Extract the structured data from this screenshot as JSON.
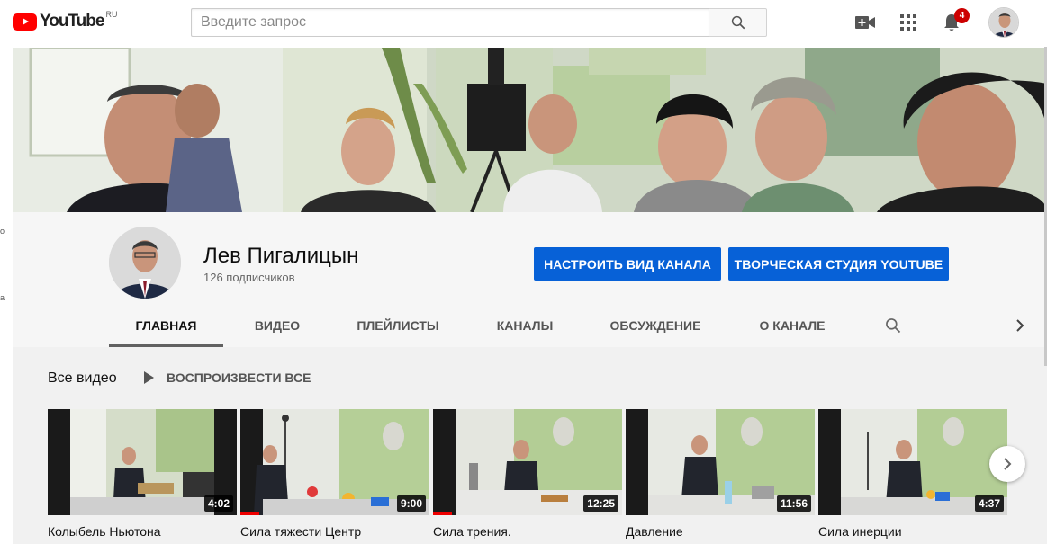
{
  "masthead": {
    "logo_text": "YouTube",
    "logo_region": "RU",
    "search_placeholder": "Введите запрос",
    "notification_count": "4",
    "icons": [
      "video-camera-icon",
      "apps-grid-icon",
      "bell-icon"
    ]
  },
  "channel": {
    "name": "Лев Пигалицын",
    "subscribers": "126 подписчиков",
    "customize_label": "НАСТРОИТЬ ВИД КАНАЛА",
    "studio_label": "ТВОРЧЕСКАЯ СТУДИЯ YOUTUBE"
  },
  "tabs": [
    {
      "label": "Главная",
      "active": true
    },
    {
      "label": "Видео"
    },
    {
      "label": "Плейлисты"
    },
    {
      "label": "Каналы"
    },
    {
      "label": "Обсуждение"
    },
    {
      "label": "О канале"
    }
  ],
  "section": {
    "title": "Все видео",
    "play_all": "ВОСПРОИЗВЕСТИ ВСЕ"
  },
  "videos": [
    {
      "title": "Колыбель Ньютона",
      "duration": "4:02",
      "watched": 0
    },
    {
      "title": "Сила тяжести Центр",
      "duration": "9:00",
      "watched": 0.1
    },
    {
      "title": "Сила трения.",
      "duration": "12:25",
      "watched": 0.1
    },
    {
      "title": "Давление",
      "duration": "11:56",
      "watched": 0
    },
    {
      "title": "Сила инерции",
      "duration": "4:37",
      "watched": 0
    }
  ],
  "left_edge": {
    "a": "о",
    "b": "а"
  },
  "colors": {
    "brand_red": "#ff0000",
    "button_blue": "#0761d7",
    "badge_red": "#cc0000"
  }
}
